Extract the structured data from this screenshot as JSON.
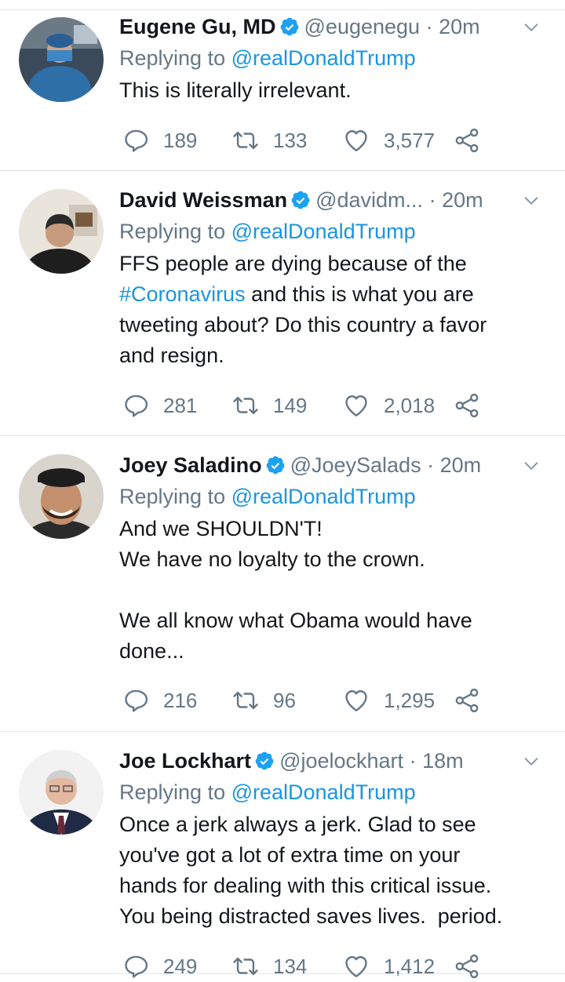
{
  "tweets": [
    {
      "name": "Eugene Gu, MD",
      "handle": "@eugenegu",
      "dot": "·",
      "time": "20m",
      "replying_prefix": "Replying to ",
      "replying_to": "@realDonaldTrump",
      "text_parts": [
        "This is literally irrelevant."
      ],
      "replies": "189",
      "retweets": "133",
      "likes": "3,577"
    },
    {
      "name": "David Weissman",
      "handle": "@davidm...",
      "dot": "·",
      "time": "20m",
      "replying_prefix": "Replying to ",
      "replying_to": "@realDonaldTrump",
      "text_parts": [
        "FFS people are dying because of the\n",
        "#Coronavirus",
        " and this is what you are\ntweeting about? Do this country a favor\nand resign."
      ],
      "replies": "281",
      "retweets": "149",
      "likes": "2,018"
    },
    {
      "name": "Joey Saladino",
      "handle": "@JoeySalads",
      "dot": "·",
      "time": "20m",
      "replying_prefix": "Replying to ",
      "replying_to": "@realDonaldTrump",
      "text_parts": [
        "And we SHOULDN'T!\nWe have no loyalty to the crown.\n\nWe all know what Obama would have\ndone..."
      ],
      "replies": "216",
      "retweets": "96",
      "likes": "1,295"
    },
    {
      "name": "Joe Lockhart",
      "handle": "@joelockhart",
      "dot": "·",
      "time": "18m",
      "replying_prefix": "Replying to ",
      "replying_to": "@realDonaldTrump",
      "text_parts": [
        "Once a jerk always a jerk. Glad to see\nyou've got a lot of extra time on your\nhands for dealing with this critical issue.\nYou being distracted saves lives.  period."
      ],
      "replies": "249",
      "retweets": "134",
      "likes": "1,412"
    }
  ],
  "icons": {
    "verified": "verified-badge-icon",
    "caret": "chevron-down-icon",
    "reply": "reply-icon",
    "retweet": "retweet-icon",
    "like": "heart-icon",
    "share": "share-icon"
  },
  "colors": {
    "link": "#1b95e0",
    "muted": "#657786",
    "text": "#14171a",
    "divider": "#e1e8ed"
  }
}
